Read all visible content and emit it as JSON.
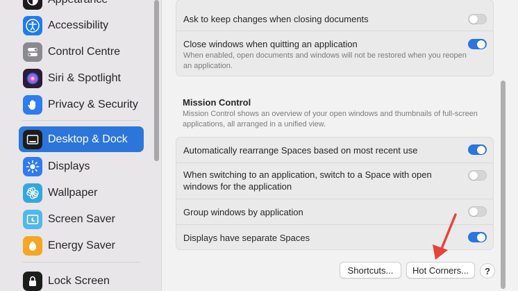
{
  "sidebar": {
    "items": [
      {
        "label": "Appearance",
        "icon": "appearance-icon",
        "color": "#1c1c1c"
      },
      {
        "label": "Accessibility",
        "icon": "accessibility-icon",
        "color": "#1e7cf0"
      },
      {
        "label": "Control Centre",
        "icon": "control-centre-icon",
        "color": "#8a8a8e"
      },
      {
        "label": "Siri & Spotlight",
        "icon": "siri-icon",
        "color": "#2b1a3a"
      },
      {
        "label": "Privacy & Security",
        "icon": "hand-icon",
        "color": "#2f7bf2"
      },
      {
        "label": "Desktop & Dock",
        "icon": "desktop-dock-icon",
        "color": "#1c1c1c",
        "selected": true
      },
      {
        "label": "Displays",
        "icon": "displays-icon",
        "color": "#2f7bf2"
      },
      {
        "label": "Wallpaper",
        "icon": "wallpaper-icon",
        "color": "#33a8e0"
      },
      {
        "label": "Screen Saver",
        "icon": "screen-saver-icon",
        "color": "#52b8e8"
      },
      {
        "label": "Energy Saver",
        "icon": "energy-saver-icon",
        "color": "#f5a623"
      },
      {
        "label": "Lock Screen",
        "icon": "lock-icon",
        "color": "#1c1c1c"
      }
    ]
  },
  "windows_group": {
    "rows": [
      {
        "label": "Ask to keep changes when closing documents",
        "toggle": false
      },
      {
        "label": "Close windows when quitting an application",
        "toggle": true,
        "description": "When enabled, open documents and windows will not be restored when you reopen an application."
      }
    ]
  },
  "mission_control": {
    "title": "Mission Control",
    "description": "Mission Control shows an overview of your open windows and thumbnails of full-screen applications, all arranged in a unified view.",
    "rows": [
      {
        "label": "Automatically rearrange Spaces based on most recent use",
        "toggle": true
      },
      {
        "label": "When switching to an application, switch to a Space with open windows for the application",
        "toggle": false
      },
      {
        "label": "Group windows by application",
        "toggle": false
      },
      {
        "label": "Displays have separate Spaces",
        "toggle": true
      }
    ]
  },
  "buttons": {
    "shortcuts": "Shortcuts...",
    "hot_corners": "Hot Corners...",
    "help": "?"
  },
  "colors": {
    "accent": "#2a75e0",
    "selection": "#2c75db",
    "annotation_arrow": "#e8433a"
  }
}
